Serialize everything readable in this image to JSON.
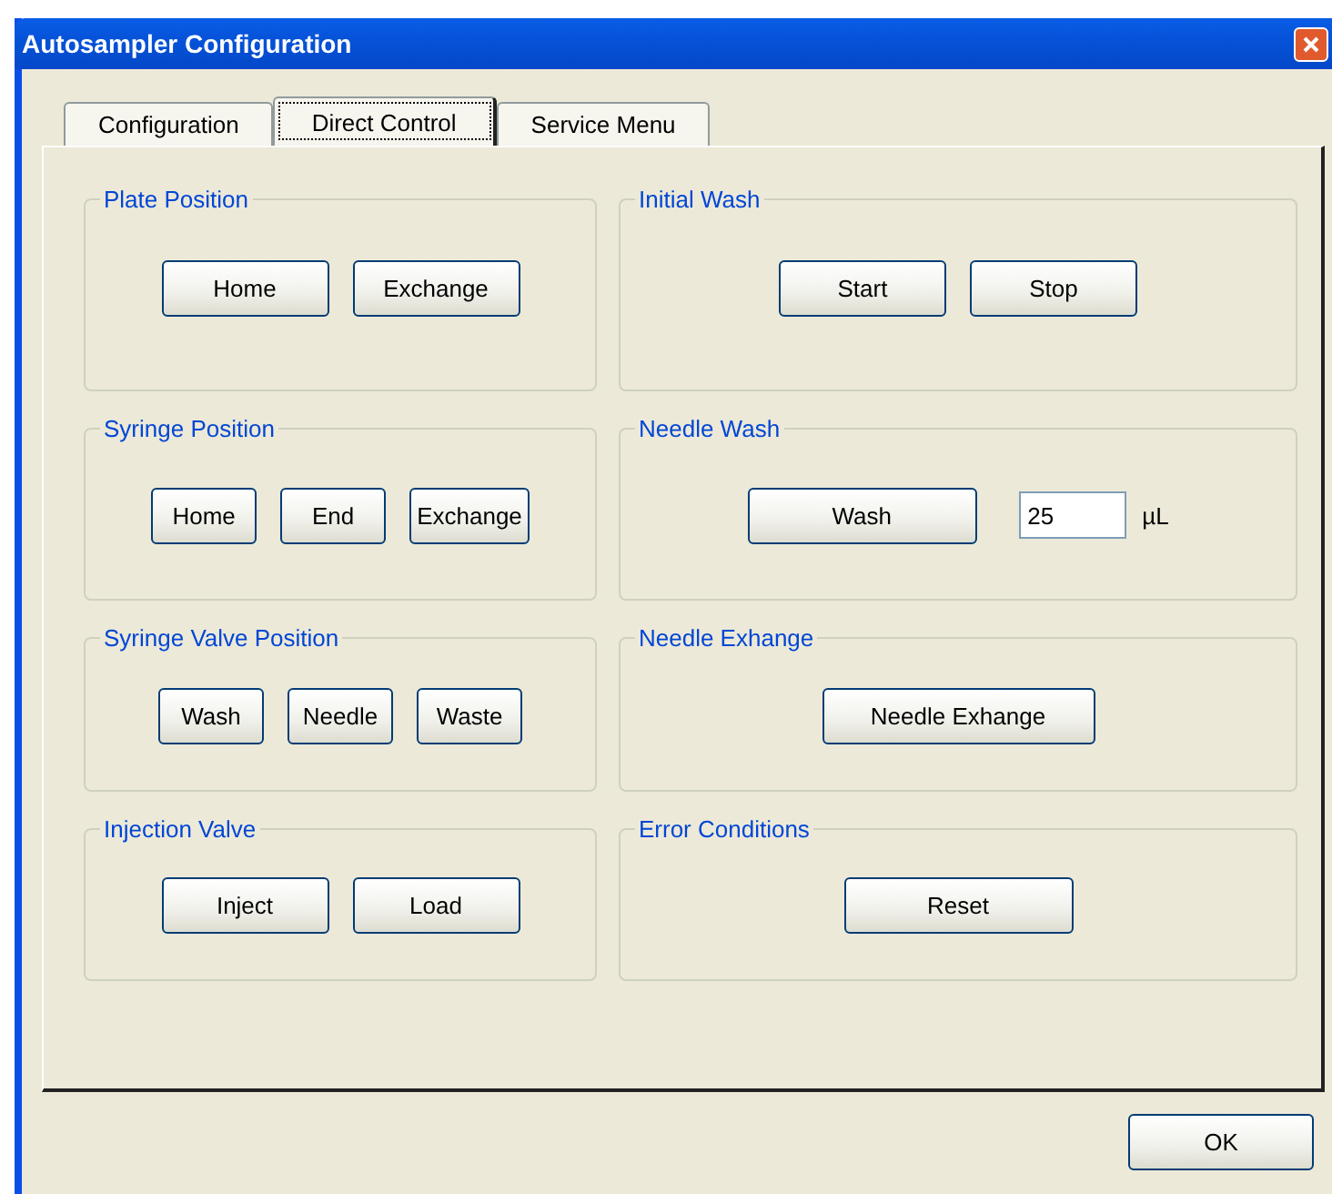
{
  "window": {
    "title": "Autosampler Configuration"
  },
  "tabs": [
    {
      "label": "Configuration",
      "selected": false
    },
    {
      "label": "Direct Control",
      "selected": true
    },
    {
      "label": "Service Menu",
      "selected": false
    }
  ],
  "groups": [
    {
      "title": "Plate Position",
      "items": [
        {
          "kind": "button",
          "label": "Home"
        },
        {
          "kind": "button",
          "label": "Exchange"
        }
      ]
    },
    {
      "title": "Initial Wash",
      "items": [
        {
          "kind": "button",
          "label": "Start"
        },
        {
          "kind": "button",
          "label": "Stop"
        }
      ]
    },
    {
      "title": "Syringe Position",
      "items": [
        {
          "kind": "button",
          "label": "Home"
        },
        {
          "kind": "button",
          "label": "End"
        },
        {
          "kind": "button",
          "label": "Exchange"
        }
      ]
    },
    {
      "title": "Needle Wash",
      "items": [
        {
          "kind": "button",
          "label": "Wash"
        },
        {
          "kind": "field",
          "value": "25"
        },
        {
          "kind": "unit",
          "text": "µL"
        }
      ]
    },
    {
      "title": "Syringe Valve Position",
      "items": [
        {
          "kind": "button",
          "label": "Wash"
        },
        {
          "kind": "button",
          "label": "Needle"
        },
        {
          "kind": "button",
          "label": "Waste"
        }
      ]
    },
    {
      "title": "Needle Exhange",
      "items": [
        {
          "kind": "button",
          "label": "Needle Exhange"
        }
      ]
    },
    {
      "title": "Injection Valve",
      "items": [
        {
          "kind": "button",
          "label": "Inject"
        },
        {
          "kind": "button",
          "label": "Load"
        }
      ]
    },
    {
      "title": "Error Conditions",
      "items": [
        {
          "kind": "button",
          "label": "Reset"
        }
      ]
    }
  ],
  "buttons": [
    {
      "label": "OK"
    }
  ]
}
